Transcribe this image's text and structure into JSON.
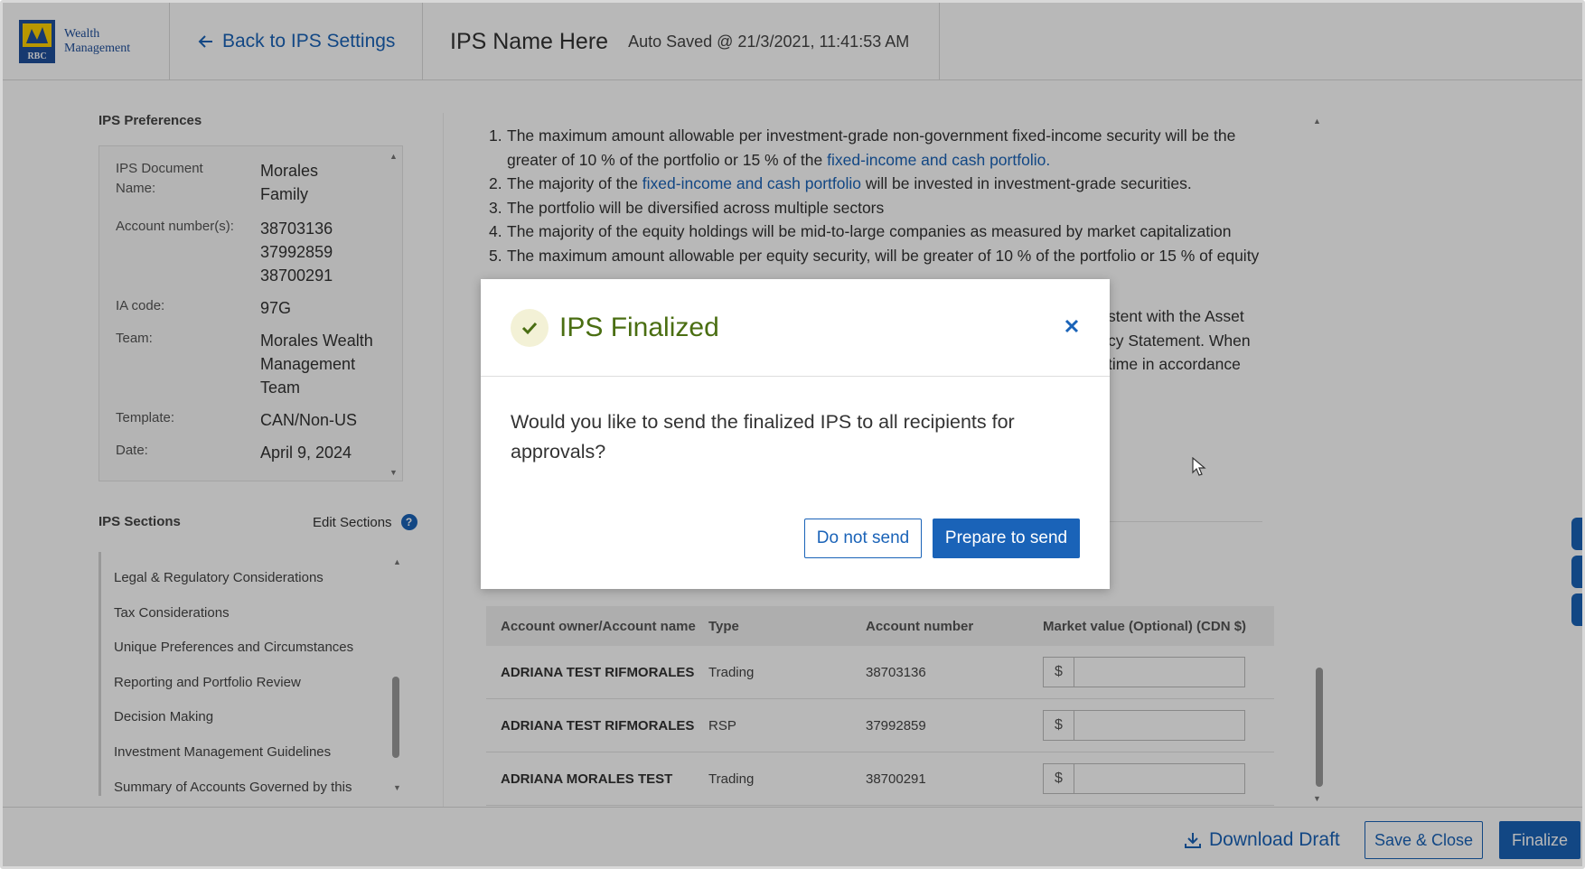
{
  "header": {
    "brand_line1": "Wealth",
    "brand_line2": "Management",
    "logo_text": "RBC",
    "back_label": "Back to IPS Settings",
    "ips_name": "IPS Name Here",
    "autosave": "Auto Saved @ 21/3/2021, 11:41:53 AM"
  },
  "preferences": {
    "title": "IPS Preferences",
    "rows": [
      {
        "label": "IPS Document Name:",
        "value": "Morales Family"
      },
      {
        "label": "Account number(s):",
        "value": "38703136 37992859 38700291"
      },
      {
        "label": "IA code:",
        "value": "97G"
      },
      {
        "label": "Team:",
        "value": "Morales Wealth Management Team"
      },
      {
        "label": "Template:",
        "value": "CAN/Non-US"
      },
      {
        "label": "Date:",
        "value": "April 9, 2024"
      }
    ]
  },
  "sections": {
    "title": "IPS Sections",
    "edit_label": "Edit Sections",
    "items": [
      "Legal & Regulatory Considerations",
      "Tax Considerations",
      "Unique Preferences and Circumstances",
      "Reporting and Portfolio Review",
      "Decision Making",
      "Investment Management Guidelines",
      "Summary of Accounts Governed by this"
    ]
  },
  "content": {
    "items": [
      {
        "n": "1.",
        "pre": "The maximum amount allowable per investment-grade non-government fixed-income security will be the greater of 10 % of the portfolio or 15 % of the ",
        "link": "fixed-income and cash portfolio.",
        "post": ""
      },
      {
        "n": "2.",
        "pre": "The majority of the ",
        "link": "fixed-income and cash portfolio",
        "post": " will be invested in investment-grade securities."
      },
      {
        "n": "3.",
        "pre": "The portfolio will be diversified across multiple sectors",
        "link": "",
        "post": ""
      },
      {
        "n": "4.",
        "pre": "The majority of the equity holdings will be mid-to-large companies as measured by market capitalization",
        "link": "",
        "post": ""
      },
      {
        "n": "5.",
        "pre": "The maximum amount allowable per equity security, will be greater of 10 % of the portfolio or 15 % of equity",
        "link": "",
        "post": ""
      }
    ],
    "partial_1": "stent with the Asset",
    "partial_2": "cy Statement. When",
    "partial_3": "time in accordance"
  },
  "accounts_table": {
    "headers": [
      "Account owner/Account name",
      "Type",
      "Account number",
      "Market value (Optional) (CDN $)"
    ],
    "currency_symbol": "$",
    "rows": [
      {
        "owner": "ADRIANA TEST RIFMORALES",
        "type": "Trading",
        "number": "38703136"
      },
      {
        "owner": "ADRIANA TEST RIFMORALES",
        "type": "RSP",
        "number": "37992859"
      },
      {
        "owner": "ADRIANA MORALES TEST",
        "type": "Trading",
        "number": "38700291"
      }
    ]
  },
  "footer": {
    "download_label": "Download Draft",
    "save_close_label": "Save & Close",
    "finalize_label": "Finalize"
  },
  "modal": {
    "title": "IPS Finalized",
    "body": "Would you like to send the finalized IPS to all recipients for approvals?",
    "do_not_send_label": "Do not send",
    "prepare_label": "Prepare to send"
  },
  "colors": {
    "accent": "#1a63b8",
    "success_title": "#4a6e12"
  }
}
